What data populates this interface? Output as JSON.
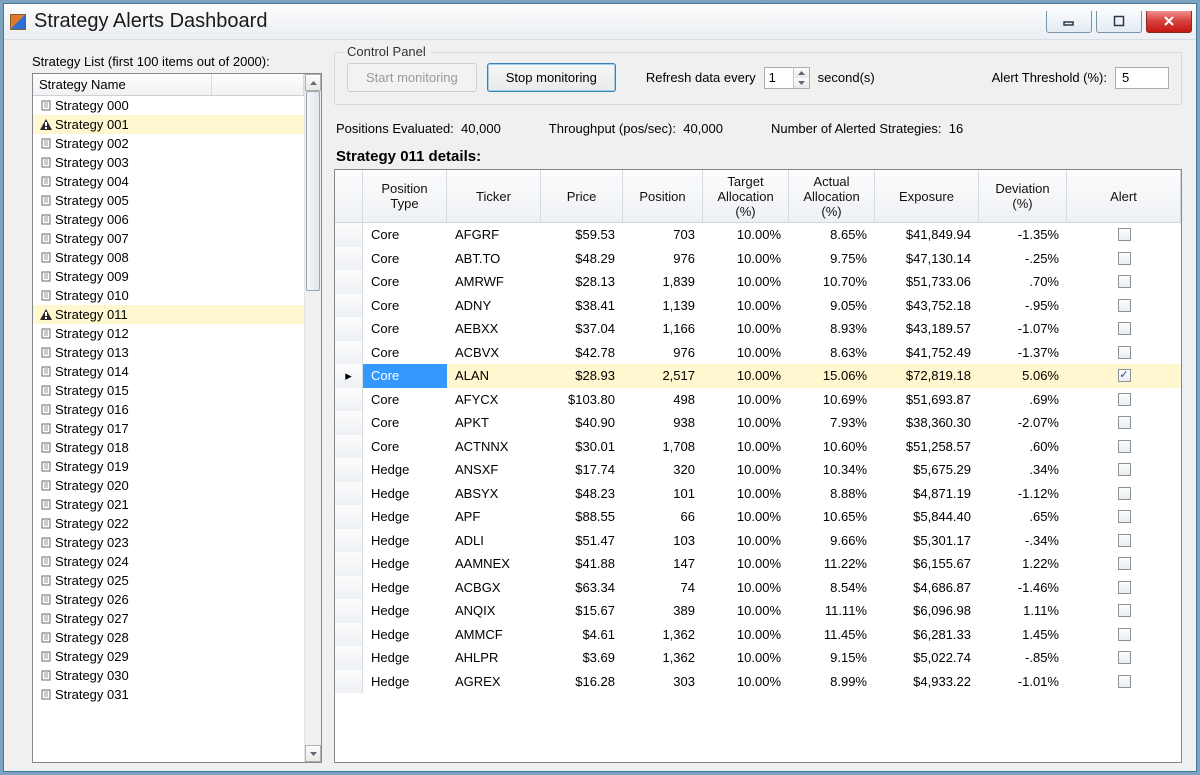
{
  "window": {
    "title": "Strategy Alerts Dashboard"
  },
  "left": {
    "label": "Strategy List (first 100 items out of 2000):",
    "header": "Strategy Name",
    "items": [
      {
        "name": "Strategy 000",
        "alerted": false
      },
      {
        "name": "Strategy 001",
        "alerted": true
      },
      {
        "name": "Strategy 002",
        "alerted": false
      },
      {
        "name": "Strategy 003",
        "alerted": false
      },
      {
        "name": "Strategy 004",
        "alerted": false
      },
      {
        "name": "Strategy 005",
        "alerted": false
      },
      {
        "name": "Strategy 006",
        "alerted": false
      },
      {
        "name": "Strategy 007",
        "alerted": false
      },
      {
        "name": "Strategy 008",
        "alerted": false
      },
      {
        "name": "Strategy 009",
        "alerted": false
      },
      {
        "name": "Strategy 010",
        "alerted": false
      },
      {
        "name": "Strategy 011",
        "alerted": true
      },
      {
        "name": "Strategy 012",
        "alerted": false
      },
      {
        "name": "Strategy 013",
        "alerted": false
      },
      {
        "name": "Strategy 014",
        "alerted": false
      },
      {
        "name": "Strategy 015",
        "alerted": false
      },
      {
        "name": "Strategy 016",
        "alerted": false
      },
      {
        "name": "Strategy 017",
        "alerted": false
      },
      {
        "name": "Strategy 018",
        "alerted": false
      },
      {
        "name": "Strategy 019",
        "alerted": false
      },
      {
        "name": "Strategy 020",
        "alerted": false
      },
      {
        "name": "Strategy 021",
        "alerted": false
      },
      {
        "name": "Strategy 022",
        "alerted": false
      },
      {
        "name": "Strategy 023",
        "alerted": false
      },
      {
        "name": "Strategy 024",
        "alerted": false
      },
      {
        "name": "Strategy 025",
        "alerted": false
      },
      {
        "name": "Strategy 026",
        "alerted": false
      },
      {
        "name": "Strategy 027",
        "alerted": false
      },
      {
        "name": "Strategy 028",
        "alerted": false
      },
      {
        "name": "Strategy 029",
        "alerted": false
      },
      {
        "name": "Strategy 030",
        "alerted": false
      },
      {
        "name": "Strategy 031",
        "alerted": false
      }
    ]
  },
  "control": {
    "legend": "Control Panel",
    "start_label": "Start monitoring",
    "stop_label": "Stop monitoring",
    "refresh_prefix": "Refresh data every",
    "refresh_value": "1",
    "refresh_suffix": "second(s)",
    "threshold_label": "Alert Threshold (%):",
    "threshold_value": "5"
  },
  "stats": {
    "positions_label": "Positions Evaluated:",
    "positions_value": "40,000",
    "throughput_label": "Throughput (pos/sec):",
    "throughput_value": "40,000",
    "alerted_label": "Number of Alerted Strategies:",
    "alerted_value": "16"
  },
  "details": {
    "title": "Strategy 011 details:",
    "headers": {
      "pt": "Position\nType",
      "tk": "Ticker",
      "pr": "Price",
      "pos": "Position",
      "ta": "Target\nAllocation\n(%)",
      "aa": "Actual\nAllocation\n(%)",
      "ex": "Exposure",
      "dev": "Deviation\n(%)",
      "al": "Alert"
    },
    "rows": [
      {
        "pt": "Core",
        "tk": "AFGRF",
        "pr": "$59.53",
        "pos": "703",
        "ta": "10.00%",
        "aa": "8.65%",
        "ex": "$41,849.94",
        "dev": "-1.35%",
        "al": false,
        "hl": false
      },
      {
        "pt": "Core",
        "tk": "ABT.TO",
        "pr": "$48.29",
        "pos": "976",
        "ta": "10.00%",
        "aa": "9.75%",
        "ex": "$47,130.14",
        "dev": "-.25%",
        "al": false,
        "hl": false
      },
      {
        "pt": "Core",
        "tk": "AMRWF",
        "pr": "$28.13",
        "pos": "1,839",
        "ta": "10.00%",
        "aa": "10.70%",
        "ex": "$51,733.06",
        "dev": ".70%",
        "al": false,
        "hl": false
      },
      {
        "pt": "Core",
        "tk": "ADNY",
        "pr": "$38.41",
        "pos": "1,139",
        "ta": "10.00%",
        "aa": "9.05%",
        "ex": "$43,752.18",
        "dev": "-.95%",
        "al": false,
        "hl": false
      },
      {
        "pt": "Core",
        "tk": "AEBXX",
        "pr": "$37.04",
        "pos": "1,166",
        "ta": "10.00%",
        "aa": "8.93%",
        "ex": "$43,189.57",
        "dev": "-1.07%",
        "al": false,
        "hl": false
      },
      {
        "pt": "Core",
        "tk": "ACBVX",
        "pr": "$42.78",
        "pos": "976",
        "ta": "10.00%",
        "aa": "8.63%",
        "ex": "$41,752.49",
        "dev": "-1.37%",
        "al": false,
        "hl": false
      },
      {
        "pt": "Core",
        "tk": "ALAN",
        "pr": "$28.93",
        "pos": "2,517",
        "ta": "10.00%",
        "aa": "15.06%",
        "ex": "$72,819.18",
        "dev": "5.06%",
        "al": true,
        "hl": true
      },
      {
        "pt": "Core",
        "tk": "AFYCX",
        "pr": "$103.80",
        "pos": "498",
        "ta": "10.00%",
        "aa": "10.69%",
        "ex": "$51,693.87",
        "dev": ".69%",
        "al": false,
        "hl": false
      },
      {
        "pt": "Core",
        "tk": "APKT",
        "pr": "$40.90",
        "pos": "938",
        "ta": "10.00%",
        "aa": "7.93%",
        "ex": "$38,360.30",
        "dev": "-2.07%",
        "al": false,
        "hl": false
      },
      {
        "pt": "Core",
        "tk": "ACTNNX",
        "pr": "$30.01",
        "pos": "1,708",
        "ta": "10.00%",
        "aa": "10.60%",
        "ex": "$51,258.57",
        "dev": ".60%",
        "al": false,
        "hl": false
      },
      {
        "pt": "Hedge",
        "tk": "ANSXF",
        "pr": "$17.74",
        "pos": "320",
        "ta": "10.00%",
        "aa": "10.34%",
        "ex": "$5,675.29",
        "dev": ".34%",
        "al": false,
        "hl": false
      },
      {
        "pt": "Hedge",
        "tk": "ABSYX",
        "pr": "$48.23",
        "pos": "101",
        "ta": "10.00%",
        "aa": "8.88%",
        "ex": "$4,871.19",
        "dev": "-1.12%",
        "al": false,
        "hl": false
      },
      {
        "pt": "Hedge",
        "tk": "APF",
        "pr": "$88.55",
        "pos": "66",
        "ta": "10.00%",
        "aa": "10.65%",
        "ex": "$5,844.40",
        "dev": ".65%",
        "al": false,
        "hl": false
      },
      {
        "pt": "Hedge",
        "tk": "ADLI",
        "pr": "$51.47",
        "pos": "103",
        "ta": "10.00%",
        "aa": "9.66%",
        "ex": "$5,301.17",
        "dev": "-.34%",
        "al": false,
        "hl": false
      },
      {
        "pt": "Hedge",
        "tk": "AAMNEX",
        "pr": "$41.88",
        "pos": "147",
        "ta": "10.00%",
        "aa": "11.22%",
        "ex": "$6,155.67",
        "dev": "1.22%",
        "al": false,
        "hl": false
      },
      {
        "pt": "Hedge",
        "tk": "ACBGX",
        "pr": "$63.34",
        "pos": "74",
        "ta": "10.00%",
        "aa": "8.54%",
        "ex": "$4,686.87",
        "dev": "-1.46%",
        "al": false,
        "hl": false
      },
      {
        "pt": "Hedge",
        "tk": "ANQIX",
        "pr": "$15.67",
        "pos": "389",
        "ta": "10.00%",
        "aa": "11.11%",
        "ex": "$6,096.98",
        "dev": "1.11%",
        "al": false,
        "hl": false
      },
      {
        "pt": "Hedge",
        "tk": "AMMCF",
        "pr": "$4.61",
        "pos": "1,362",
        "ta": "10.00%",
        "aa": "11.45%",
        "ex": "$6,281.33",
        "dev": "1.45%",
        "al": false,
        "hl": false
      },
      {
        "pt": "Hedge",
        "tk": "AHLPR",
        "pr": "$3.69",
        "pos": "1,362",
        "ta": "10.00%",
        "aa": "9.15%",
        "ex": "$5,022.74",
        "dev": "-.85%",
        "al": false,
        "hl": false
      },
      {
        "pt": "Hedge",
        "tk": "AGREX",
        "pr": "$16.28",
        "pos": "303",
        "ta": "10.00%",
        "aa": "8.99%",
        "ex": "$4,933.22",
        "dev": "-1.01%",
        "al": false,
        "hl": false
      }
    ]
  }
}
